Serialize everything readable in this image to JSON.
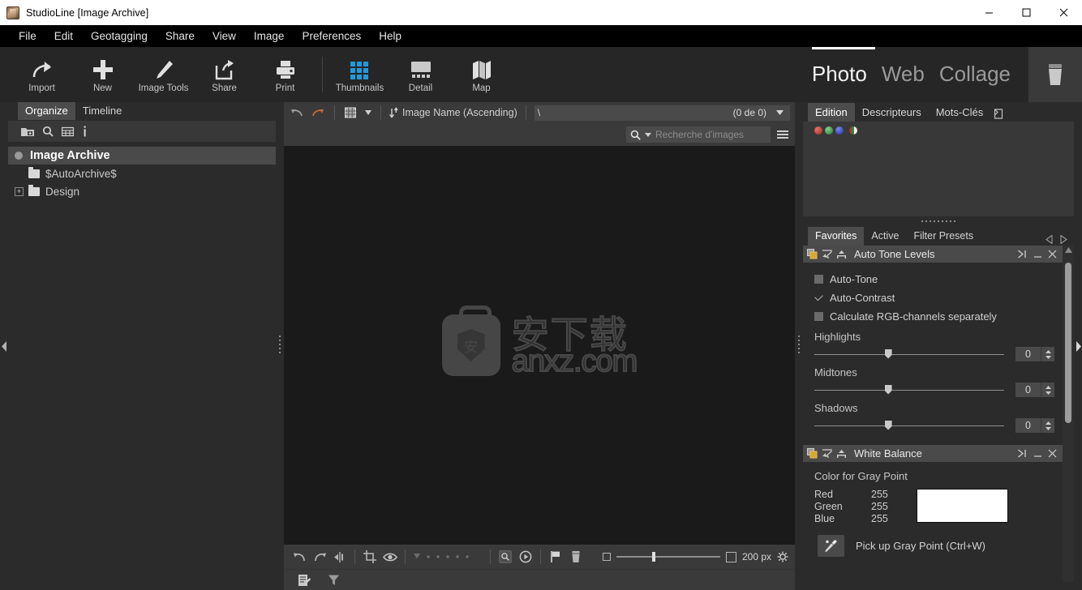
{
  "window": {
    "title": "StudioLine [Image Archive]",
    "icon": "app-icon",
    "controls": {
      "minimize": "minimize-icon",
      "maximize": "maximize-icon",
      "close": "close-icon"
    }
  },
  "menubar": {
    "items": [
      {
        "label": "File"
      },
      {
        "label": "Edit"
      },
      {
        "label": "Geotagging"
      },
      {
        "label": "Share"
      },
      {
        "label": "View"
      },
      {
        "label": "Image"
      },
      {
        "label": "Preferences"
      },
      {
        "label": "Help"
      }
    ]
  },
  "ribbon": {
    "buttons": [
      {
        "label": "Import",
        "icon": "import-arrow-icon"
      },
      {
        "label": "New",
        "icon": "plus-icon"
      },
      {
        "label": "Image Tools",
        "icon": "wand-icon"
      },
      {
        "label": "Share",
        "icon": "share-export-icon"
      },
      {
        "label": "Print",
        "icon": "printer-icon"
      }
    ],
    "view_buttons": [
      {
        "label": "Thumbnails",
        "icon": "grid-icon"
      },
      {
        "label": "Detail",
        "icon": "detail-icon"
      },
      {
        "label": "Map",
        "icon": "map-icon"
      }
    ],
    "modes": [
      {
        "label": "Photo",
        "active": true
      },
      {
        "label": "Web",
        "active": false
      },
      {
        "label": "Collage",
        "active": false
      }
    ],
    "trash": "trash-icon",
    "accent_color": "#1e9bdd"
  },
  "left_panel": {
    "tabs": [
      {
        "label": "Organize",
        "active": true
      },
      {
        "label": "Timeline",
        "active": false
      }
    ],
    "tools": [
      {
        "icon": "new-folder-icon"
      },
      {
        "icon": "search-icon"
      },
      {
        "icon": "table-icon"
      },
      {
        "icon": "info-icon"
      }
    ],
    "tree": [
      {
        "label": "Image Archive",
        "type": "root",
        "selected": true
      },
      {
        "label": "$AutoArchive$",
        "type": "folder",
        "expandable": false
      },
      {
        "label": "Design",
        "type": "folder",
        "expandable": true
      }
    ]
  },
  "center": {
    "toolbar": {
      "undo": "undo-arrow-icon",
      "redo": "redo-arrow-icon",
      "view_mode": "grid-dropdown-icon",
      "sort_icon": "sort-ascending-icon",
      "sort_label": "Image Name (Ascending)"
    },
    "path": {
      "value": "\\",
      "count": "(0 de 0)",
      "dropdown": "chevron-down-icon"
    },
    "search": {
      "icon": "search-icon",
      "placeholder": "Recherche d'images",
      "menu": "hamburger-icon"
    },
    "canvas": {
      "watermark_cn": "安下载",
      "watermark_url": "anxz.com",
      "watermark_mark": "安"
    },
    "bottom_toolbar": {
      "buttons": [
        {
          "icon": "rotate-left-icon"
        },
        {
          "icon": "rotate-right-icon"
        },
        {
          "icon": "flip-icon"
        },
        {
          "icon": "crop-icon"
        },
        {
          "icon": "eye-icon"
        },
        {
          "icon": "rating-stars-icon"
        },
        {
          "icon": "zoom-box-icon"
        },
        {
          "icon": "play-circle-icon"
        },
        {
          "icon": "flag-icon"
        },
        {
          "icon": "trash-icon"
        }
      ],
      "row2": [
        {
          "icon": "notes-icon"
        },
        {
          "icon": "filter-funnel-icon"
        }
      ],
      "zoom": {
        "min_icon": "small-square-icon",
        "max_icon": "large-square-icon",
        "value": "200 px",
        "settings": "gear-icon"
      }
    }
  },
  "right_panel": {
    "tabs": [
      {
        "label": "Edition",
        "active": true
      },
      {
        "label": "Descripteurs",
        "active": false
      },
      {
        "label": "Mots-Clés",
        "active": false
      }
    ],
    "tab_extra_icon": "detach-icon",
    "channel_spheres": [
      "#c0392b",
      "#3b9e4a",
      "#2f45c8",
      "#3b9e4a",
      "#f2f2f2"
    ],
    "filter_tabs": [
      {
        "label": "Favorites",
        "active": true
      },
      {
        "label": "Active",
        "active": false
      },
      {
        "label": "Filter Presets",
        "active": false
      }
    ],
    "filter_nav": {
      "prev": "chevron-left-icon",
      "next": "chevron-right-icon"
    },
    "panels": [
      {
        "title": "Auto Tone Levels",
        "head_icons": [
          "copy-settings-icon",
          "collapse-icon",
          "apply-icon"
        ],
        "head_tools": [
          "expand-icon",
          "minimize-icon",
          "close-icon"
        ],
        "checkboxes": [
          {
            "label": "Auto-Tone",
            "checked": false
          },
          {
            "label": "Auto-Contrast",
            "checked": true
          },
          {
            "label": "Calculate RGB-channels separately",
            "checked": false
          }
        ],
        "sliders": [
          {
            "label": "Highlights",
            "value": "0"
          },
          {
            "label": "Midtones",
            "value": "0"
          },
          {
            "label": "Shadows",
            "value": "0"
          }
        ]
      },
      {
        "title": "White Balance",
        "head_icons": [
          "copy-settings-icon",
          "collapse-icon",
          "apply-icon"
        ],
        "head_tools": [
          "expand-icon",
          "minimize-icon",
          "close-icon"
        ],
        "section_title": "Color for Gray Point",
        "channels": [
          {
            "name": "Red",
            "value": "255"
          },
          {
            "name": "Green",
            "value": "255"
          },
          {
            "name": "Blue",
            "value": "255"
          }
        ],
        "swatch_color": "#ffffff",
        "pick_button": {
          "icon": "eyedropper-icon",
          "label": "Pick up Gray Point (Ctrl+W)"
        }
      }
    ]
  }
}
